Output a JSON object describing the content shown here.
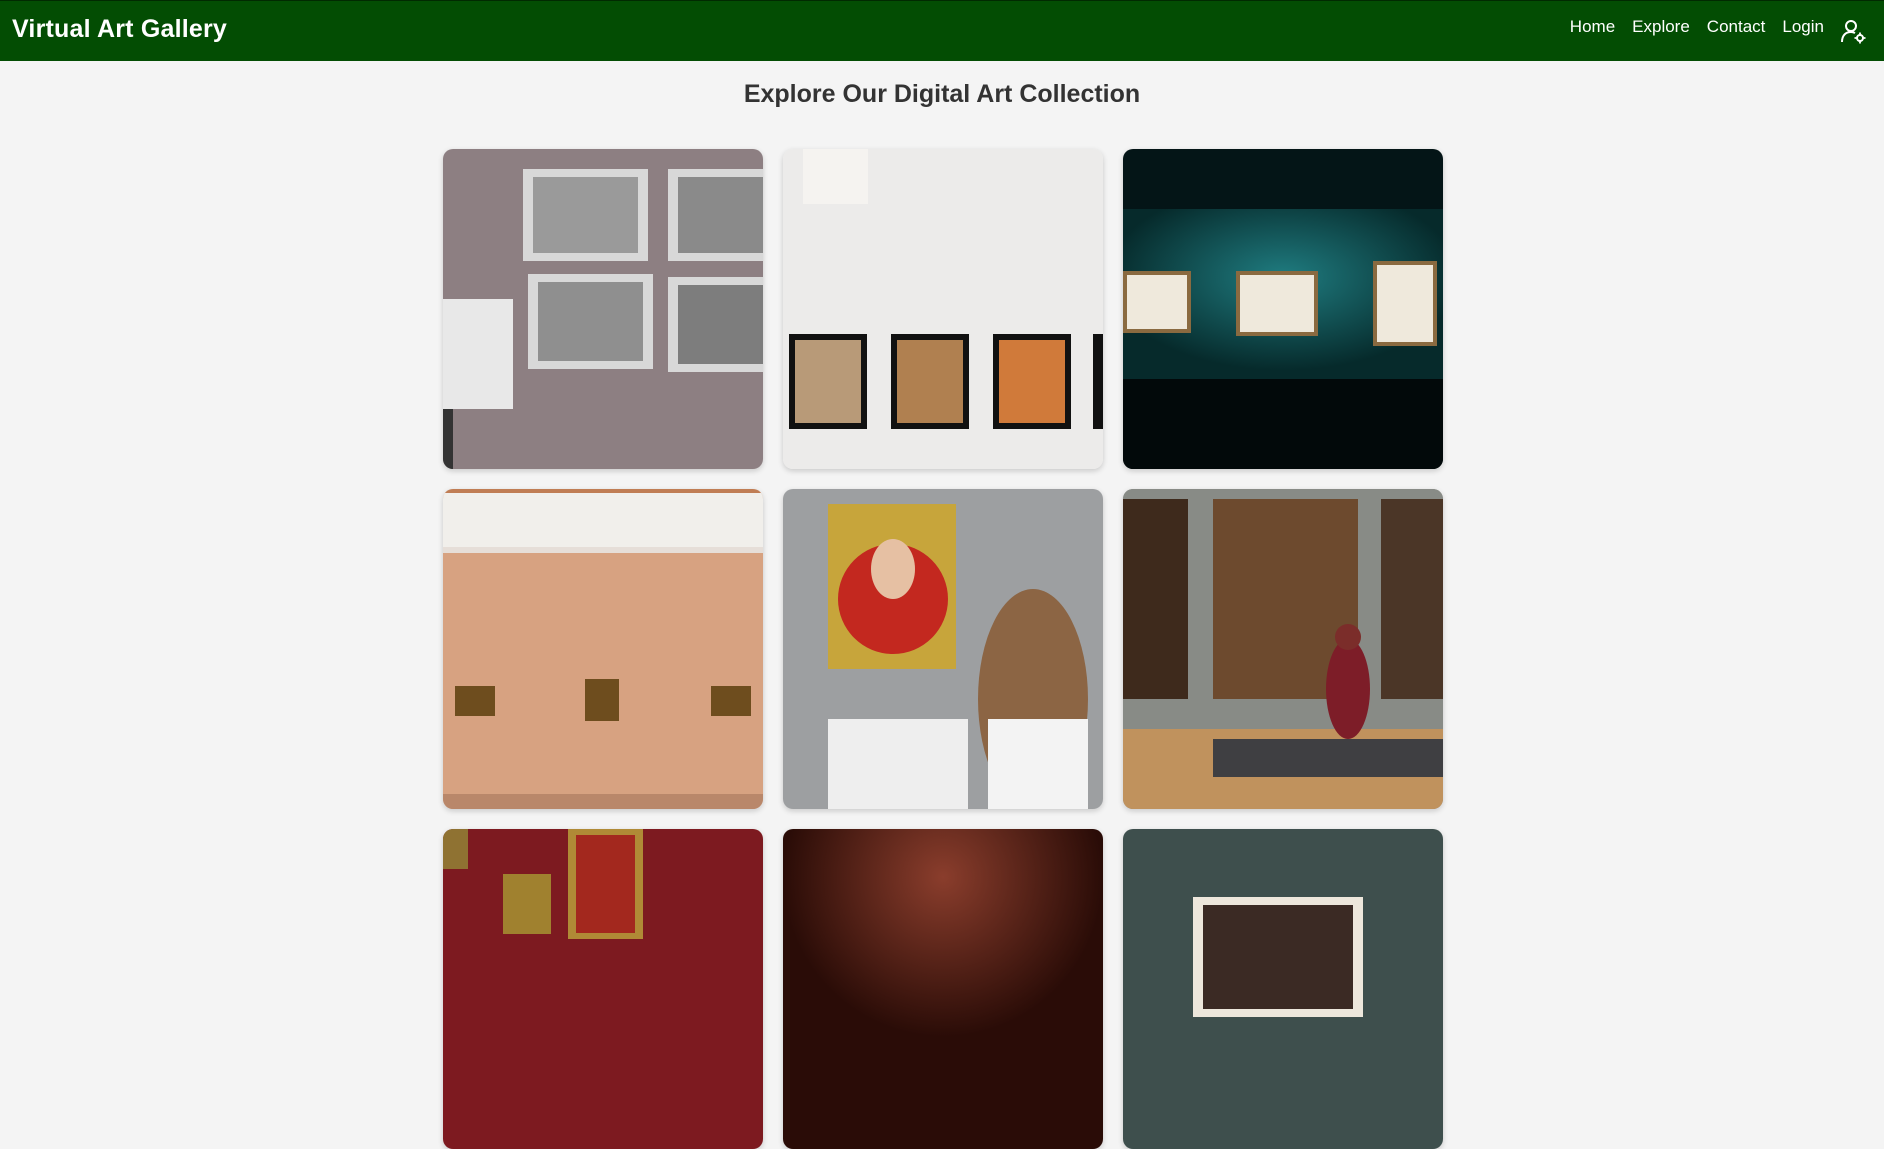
{
  "header": {
    "brand": "Virtual Art Gallery",
    "nav": [
      "Home",
      "Explore",
      "Contact",
      "Login"
    ],
    "user_icon": "user-settings-icon",
    "bg_color": "#034d03"
  },
  "main": {
    "title": "Explore Our Digital Art Collection"
  },
  "gallery": {
    "items": [
      {
        "name": "gallery-image-framed-photos"
      },
      {
        "name": "gallery-image-white-wall-frames"
      },
      {
        "name": "gallery-image-teal-wall-spotlights"
      },
      {
        "name": "gallery-image-peach-wall"
      },
      {
        "name": "gallery-image-woman-viewing-portrait"
      },
      {
        "name": "gallery-image-woman-on-bench"
      },
      {
        "name": "gallery-image-red-wall-portraits"
      },
      {
        "name": "gallery-image-dark-red-spotlights"
      },
      {
        "name": "gallery-image-teal-framed-picture"
      }
    ]
  }
}
